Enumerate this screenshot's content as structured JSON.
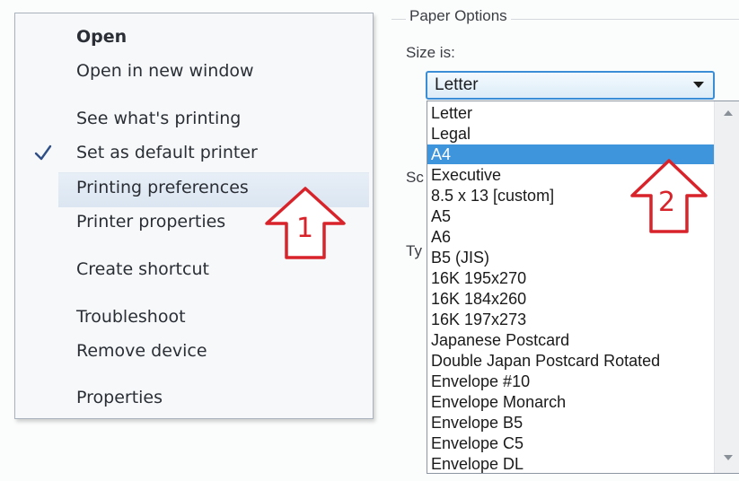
{
  "context_menu": {
    "items": [
      {
        "label": "Open"
      },
      {
        "label": "Open in new window"
      },
      {
        "label": "See what's printing"
      },
      {
        "label": "Set as default printer"
      },
      {
        "label": "Printing preferences"
      },
      {
        "label": "Printer properties"
      },
      {
        "label": "Create shortcut"
      },
      {
        "label": "Troubleshoot"
      },
      {
        "label": "Remove device"
      },
      {
        "label": "Properties"
      }
    ],
    "check_icon": "checkmark-icon"
  },
  "annotations": {
    "arrow_1": "1",
    "arrow_2": "2",
    "color": "#d8232a"
  },
  "paper_options": {
    "group_title": "Paper Options",
    "size_label": "Size is:",
    "clipped_label_1": "Sc",
    "clipped_label_2": "Ty",
    "selected_size": "Letter",
    "sizes": [
      "Letter",
      "Legal",
      "A4",
      "Executive",
      "8.5 x 13 [custom]",
      "A5",
      "A6",
      "B5 (JIS)",
      "16K 195x270",
      "16K 184x260",
      "16K 197x273",
      "Japanese Postcard",
      "Double Japan Postcard Rotated",
      "Envelope #10",
      "Envelope Monarch",
      "Envelope B5",
      "Envelope C5",
      "Envelope DL"
    ],
    "highlighted_size": "A4",
    "accent_color": "#3f95dc"
  }
}
